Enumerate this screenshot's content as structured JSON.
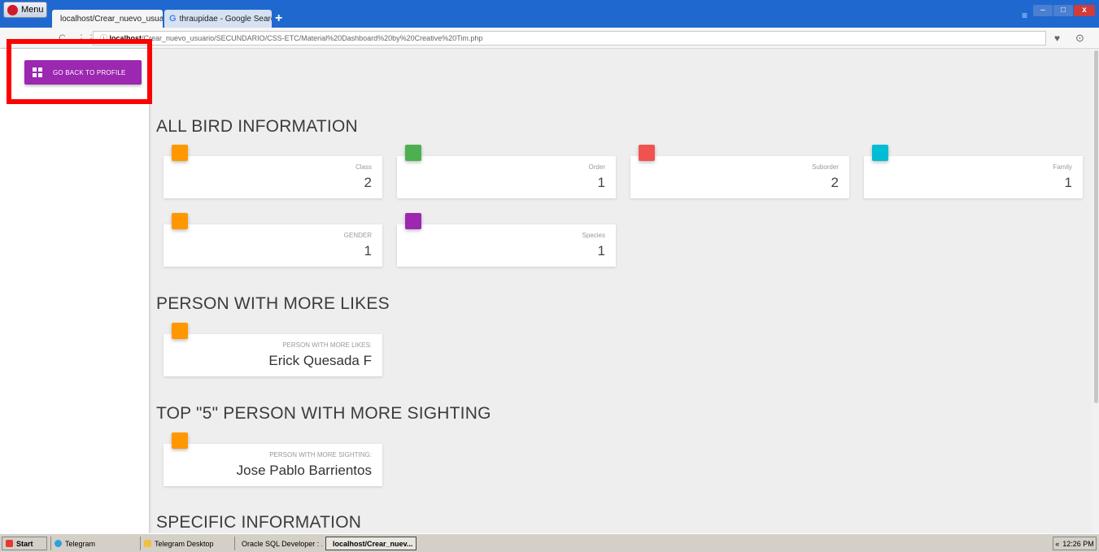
{
  "browser": {
    "menu_label": "Menu",
    "tabs": [
      {
        "title": "localhost/Crear_nuevo_usuar"
      },
      {
        "title": "thraupidae - Google Search"
      }
    ],
    "new_tab": "+",
    "url_host": "localhost",
    "url_path": "/Crear_nuevo_usuario/SECUNDARIO/CSS-ETC/Material%20Dashboard%20by%20Creative%20Tim.php"
  },
  "sidebar": {
    "back_button_label": "GO BACK TO PROFILE"
  },
  "sections": {
    "all_bird": {
      "title": "ALL BIRD INFORMATION",
      "cards": [
        {
          "label": "Class",
          "value": "2",
          "color": "#ff9800"
        },
        {
          "label": "Order",
          "value": "1",
          "color": "#4caf50"
        },
        {
          "label": "Suborder",
          "value": "2",
          "color": "#ef5350"
        },
        {
          "label": "Family",
          "value": "1",
          "color": "#00bcd4"
        },
        {
          "label": "GENDER",
          "value": "1",
          "color": "#ff9800"
        },
        {
          "label": "Species",
          "value": "1",
          "color": "#9c27b0"
        }
      ]
    },
    "likes": {
      "title": "PERSON WITH MORE LIKES",
      "card": {
        "label": "PERSON WITH MORE LIKES:",
        "value": "Erick Quesada F",
        "color": "#ff9800"
      }
    },
    "sighting": {
      "title": "TOP \"5\" PERSON WITH MORE SIGHTING",
      "card": {
        "label": "PERSON WITH MORE SIGHTING:",
        "value": "Jose Pablo Barrientos",
        "color": "#ff9800"
      }
    },
    "specific": {
      "title": "SPECIFIC INFORMATION"
    }
  },
  "taskbar": {
    "start": "Start",
    "items": [
      "Telegram",
      "Telegram Desktop",
      "Oracle SQL Developer : ...",
      "localhost/Crear_nuev..."
    ],
    "clock": "12:26 PM"
  }
}
